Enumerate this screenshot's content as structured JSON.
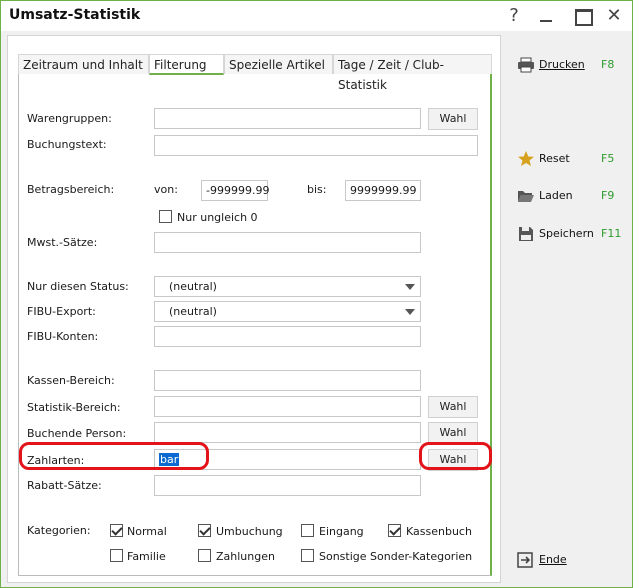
{
  "window": {
    "title": "Umsatz-Statistik",
    "help_glyph": "?",
    "close_glyph": "✕"
  },
  "tabs": [
    {
      "label": "Zeitraum und Inhalt"
    },
    {
      "label": "Filterung"
    },
    {
      "label": "Spezielle Artikel"
    },
    {
      "label": "Tage / Zeit / Club-Statistik"
    }
  ],
  "form": {
    "warengruppen": {
      "label": "Warengruppen:",
      "value": "",
      "button": "Wahl"
    },
    "buchungstext": {
      "label": "Buchungstext:",
      "value": ""
    },
    "betragsbereich": {
      "label": "Betragsbereich:",
      "von_label": "von:",
      "von_value": "-999999.99",
      "bis_label": "bis:",
      "bis_value": "9999999.99"
    },
    "nur_ungleich": {
      "label": "Nur ungleich 0",
      "checked": false
    },
    "mwst": {
      "label": "Mwst.-Sätze:",
      "value": ""
    },
    "status": {
      "label": "Nur diesen Status:",
      "value": "(neutral)"
    },
    "fibu_export": {
      "label": "FIBU-Export:",
      "value": "(neutral)"
    },
    "fibu_konten": {
      "label": "FIBU-Konten:",
      "value": ""
    },
    "kassen_bereich": {
      "label": "Kassen-Bereich:",
      "value": ""
    },
    "statistik_bereich": {
      "label": "Statistik-Bereich:",
      "value": "",
      "button": "Wahl"
    },
    "buchende_person": {
      "label": "Buchende Person:",
      "value": "",
      "button": "Wahl"
    },
    "zahlarten": {
      "label": "Zahlarten:",
      "value": "bar",
      "button": "Wahl"
    },
    "rabatt": {
      "label": "Rabatt-Sätze:",
      "value": ""
    }
  },
  "kategorien": {
    "label": "Kategorien:",
    "items": [
      {
        "label": "Normal",
        "checked": true
      },
      {
        "label": "Umbuchung",
        "checked": true
      },
      {
        "label": "Eingang",
        "checked": false
      },
      {
        "label": "Kassenbuch",
        "checked": true
      },
      {
        "label": "Familie",
        "checked": false
      },
      {
        "label": "Zahlungen",
        "checked": false
      },
      {
        "label": "Sonstige Sonder-Kategorien",
        "checked": false
      }
    ]
  },
  "side": {
    "drucken": {
      "label": "Drucken",
      "key": "F8"
    },
    "reset": {
      "label": "Reset",
      "key": "F5"
    },
    "laden": {
      "label": "Laden",
      "key": "F9"
    },
    "speichern": {
      "label": "Speichern",
      "key": "F11"
    },
    "ende": {
      "label": "Ende"
    }
  },
  "colors": {
    "accent_green": "#6fb04a",
    "highlight_red": "#e3131a",
    "selection_blue": "#0c6bd0",
    "hotkey_green": "#2e9a2e",
    "star_gold": "#d6a21e"
  }
}
